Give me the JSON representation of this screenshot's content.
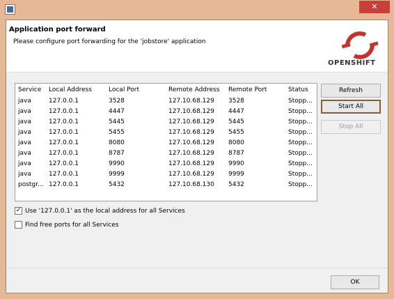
{
  "window": {
    "close_glyph": "✕"
  },
  "header": {
    "title": "Application port forward",
    "description": "Please configure port forwarding for the 'jobstore' application",
    "logo_text": "OPENSHIFT",
    "logo_color": "#c1352e"
  },
  "table": {
    "columns": [
      "Service",
      "Local Address",
      "Local Port",
      "Remote Address",
      "Remote Port",
      "Status"
    ],
    "rows": [
      [
        "java",
        "127.0.0.1",
        "3528",
        "127.10.68.129",
        "3528",
        "Stopp..."
      ],
      [
        "java",
        "127.0.0.1",
        "4447",
        "127.10.68.129",
        "4447",
        "Stopp..."
      ],
      [
        "java",
        "127.0.0.1",
        "5445",
        "127.10.68.129",
        "5445",
        "Stopp..."
      ],
      [
        "java",
        "127.0.0.1",
        "5455",
        "127.10.68.129",
        "5455",
        "Stopp..."
      ],
      [
        "java",
        "127.0.0.1",
        "8080",
        "127.10.68.129",
        "8080",
        "Stopp..."
      ],
      [
        "java",
        "127.0.0.1",
        "8787",
        "127.10.68.129",
        "8787",
        "Stopp..."
      ],
      [
        "java",
        "127.0.0.1",
        "9990",
        "127.10.68.129",
        "9990",
        "Stopp..."
      ],
      [
        "java",
        "127.0.0.1",
        "9999",
        "127.10.68.129",
        "9999",
        "Stopp..."
      ],
      [
        "postgr...",
        "127.0.0.1",
        "5432",
        "127.10.68.130",
        "5432",
        "Stopp..."
      ]
    ]
  },
  "buttons": {
    "refresh": "Refresh",
    "start_all": "Start All",
    "stop_all": "Stop All",
    "ok": "OK"
  },
  "options": {
    "use_local": {
      "label": "Use '127.0.0.1' as the local address for all Services",
      "checked": true
    },
    "find_free": {
      "label": "Find free ports for all Services",
      "checked": false
    }
  }
}
